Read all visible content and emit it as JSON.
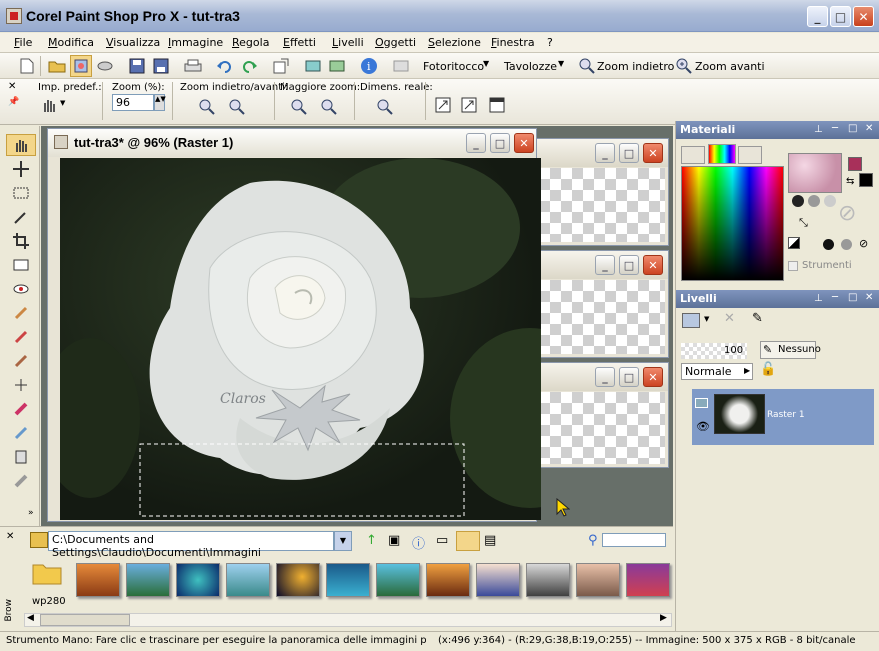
{
  "window": {
    "title": "Corel Paint Shop Pro X - tut-tra3"
  },
  "menu": [
    "File",
    "Modifica",
    "Visualizza",
    "Immagine",
    "Regola",
    "Effetti",
    "Livelli",
    "Oggetti",
    "Selezione",
    "Finestra",
    "?"
  ],
  "toolbar": {
    "fotoritocco": "Fotoritocco",
    "tavolozze": "Tavolozze",
    "zoom_out": "Zoom indietro",
    "zoom_in": "Zoom avanti"
  },
  "tool_options": {
    "preset_label": "Imp. predef.:",
    "zoom_pct_label": "Zoom (%):",
    "zoom_value": "96",
    "zoom_inout_label": "Zoom indietro/avanti:",
    "max_zoom_label": "Maggiore zoom:",
    "actual_size_label": "Dimens. reale:"
  },
  "document": {
    "title": "tut-tra3* @  96% (Raster 1)",
    "watermark": "Claros"
  },
  "panels": {
    "materials": {
      "title": "Materiali",
      "textures_label": "Strumenti",
      "fg_color": "#a8305a",
      "bg_color": "#000000"
    },
    "layers": {
      "title": "Livelli",
      "opacity": "100",
      "blend_mode": "Normale",
      "group_label": "Nessuno",
      "layer_name": "Raster 1"
    }
  },
  "browser": {
    "path": "C:\\Documents and Settings\\Claudio\\Documenti\\Immagini",
    "folder": "wp280",
    "label": "Brow"
  },
  "status": {
    "text": "Strumento Mano: Fare clic e trascinare per eseguire la panoramica delle immagini più gra",
    "info": "(x:496 y:364) - (R:29,G:38,B:19,O:255) -- Immagine:  500 x 375 x RGB - 8 bit/canale"
  }
}
